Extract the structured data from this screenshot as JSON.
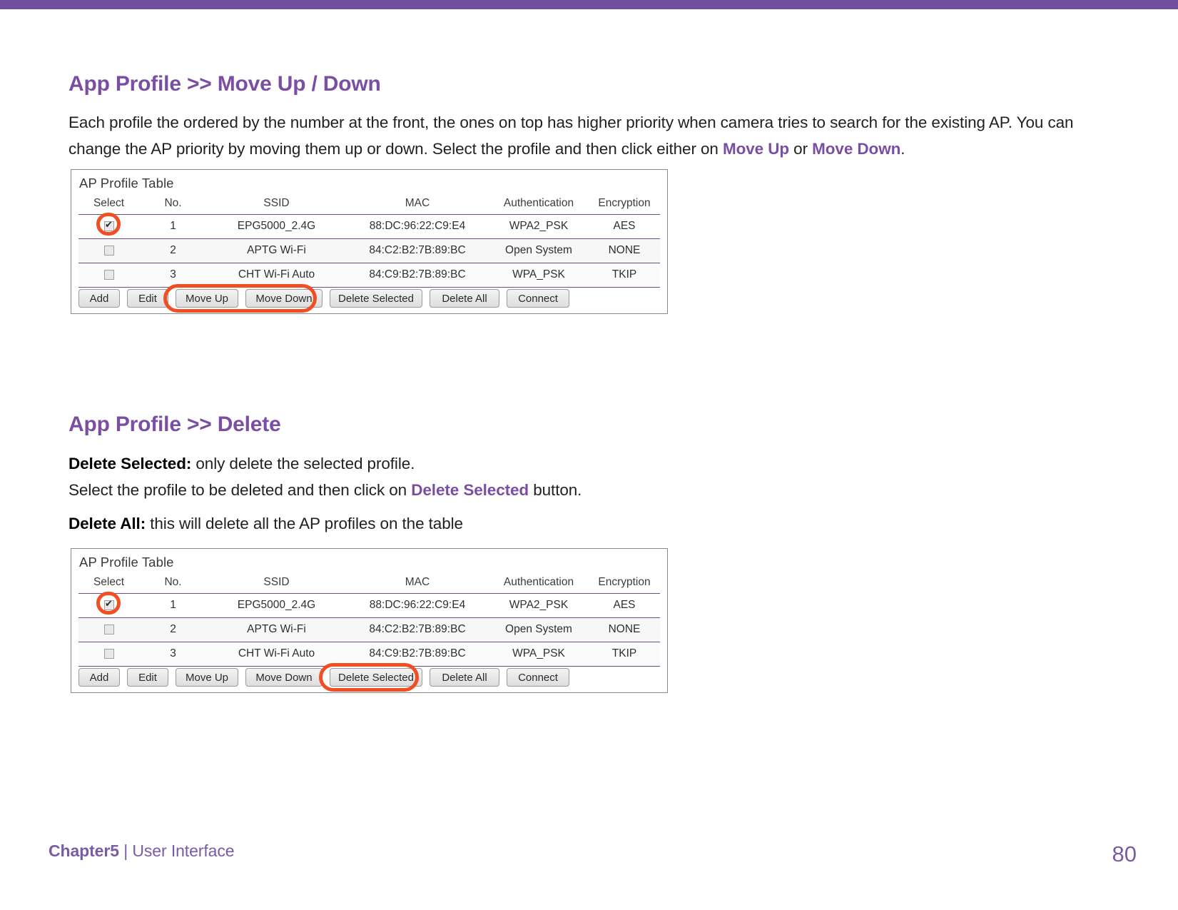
{
  "document": {
    "page_number": "80",
    "footer_chapter": "Chapter5",
    "footer_separator": "|",
    "footer_section": "User Interface",
    "accent_color": "#7a4fa3",
    "topbar_color": "#6f4f9e",
    "highlight_color": "#f04e23"
  },
  "sections": [
    {
      "heading": "App Profile >> Move Up / Down",
      "paragraph_line1": "Each profile the ordered by the number at the front, the ones on top has higher priority when camera tries to search for the existing",
      "paragraph_line2_a": "AP. You can change the AP priority by moving them up or down. Select the profile and then click either on ",
      "paragraph_line2_hl1": "Move Up",
      "paragraph_line2_b": " or ",
      "paragraph_line2_hl2": "Move Down",
      "paragraph_line2_c": "."
    },
    {
      "heading": "App Profile >> Delete",
      "line1_bold": "Delete Selected:",
      "line1_rest": " only delete the selected profile.",
      "line2_a": "Select the profile to be deleted and then click on ",
      "line2_hl": "Delete Selected",
      "line2_b": " button.",
      "line3_bold": "Delete All:",
      "line3_rest": " this will delete all the AP profiles on the table"
    }
  ],
  "ap_profile_table": {
    "title": "AP Profile Table",
    "columns": [
      "Select",
      "No.",
      "SSID",
      "MAC",
      "Authentication",
      "Encryption"
    ],
    "rows": [
      {
        "selected": true,
        "no": "1",
        "ssid": "EPG5000_2.4G",
        "mac": "88:DC:96:22:C9:E4",
        "authentication": "WPA2_PSK",
        "encryption": "AES"
      },
      {
        "selected": false,
        "no": "2",
        "ssid": "APTG Wi-Fi",
        "mac": "84:C2:B2:7B:89:BC",
        "authentication": "Open System",
        "encryption": "NONE"
      },
      {
        "selected": false,
        "no": "3",
        "ssid": "CHT Wi-Fi Auto",
        "mac": "84:C9:B2:7B:89:BC",
        "authentication": "WPA_PSK",
        "encryption": "TKIP"
      }
    ],
    "buttons": [
      "Add",
      "Edit",
      "Move Up",
      "Move Down",
      "Delete Selected",
      "Delete All",
      "Connect"
    ]
  },
  "annotations": {
    "figure1_highlighted_buttons": [
      "Move Up",
      "Move Down"
    ],
    "figure2_highlighted_buttons": [
      "Delete Selected"
    ],
    "highlighted_checkbox_row": "1"
  }
}
